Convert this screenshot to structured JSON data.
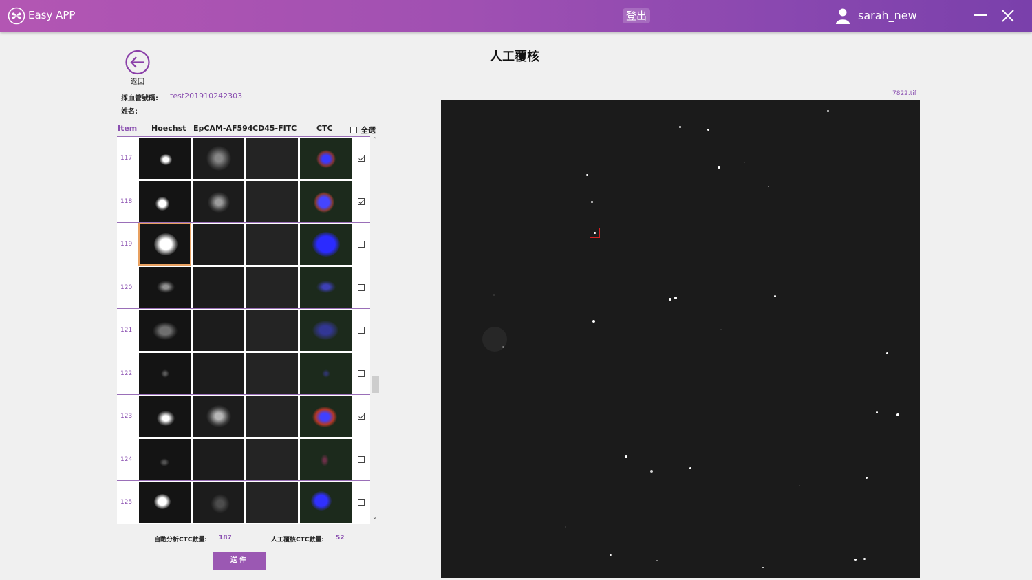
{
  "app": {
    "name": "Easy APP",
    "logout_label": "登出",
    "username": "sarah_new"
  },
  "left": {
    "back_label": "返回",
    "tube_label": "採血管號碼:",
    "tube_value": "test201910242303",
    "name_label": "姓名:",
    "name_value": "",
    "columns": [
      "Item",
      "Hoechst",
      "EpCAM-AF594",
      "CD45-FITC",
      "CTC"
    ],
    "select_all_label": "全選",
    "rows": [
      {
        "item": "117",
        "checked": true
      },
      {
        "item": "118",
        "checked": true
      },
      {
        "item": "119",
        "checked": false
      },
      {
        "item": "120",
        "checked": false
      },
      {
        "item": "121",
        "checked": false
      },
      {
        "item": "122",
        "checked": false
      },
      {
        "item": "123",
        "checked": true
      },
      {
        "item": "124",
        "checked": false
      },
      {
        "item": "125",
        "checked": false
      }
    ],
    "auto_count_label": "自動分析CTC數量:",
    "auto_count_value": "187",
    "manual_count_label": "人工覆核CTC數量:",
    "manual_count_value": "52",
    "send_label": "送件"
  },
  "right": {
    "title": "人工覆核",
    "file_name": "7822.tif"
  },
  "colors": {
    "accent": "#9b58b3",
    "roi": "#d42020"
  }
}
